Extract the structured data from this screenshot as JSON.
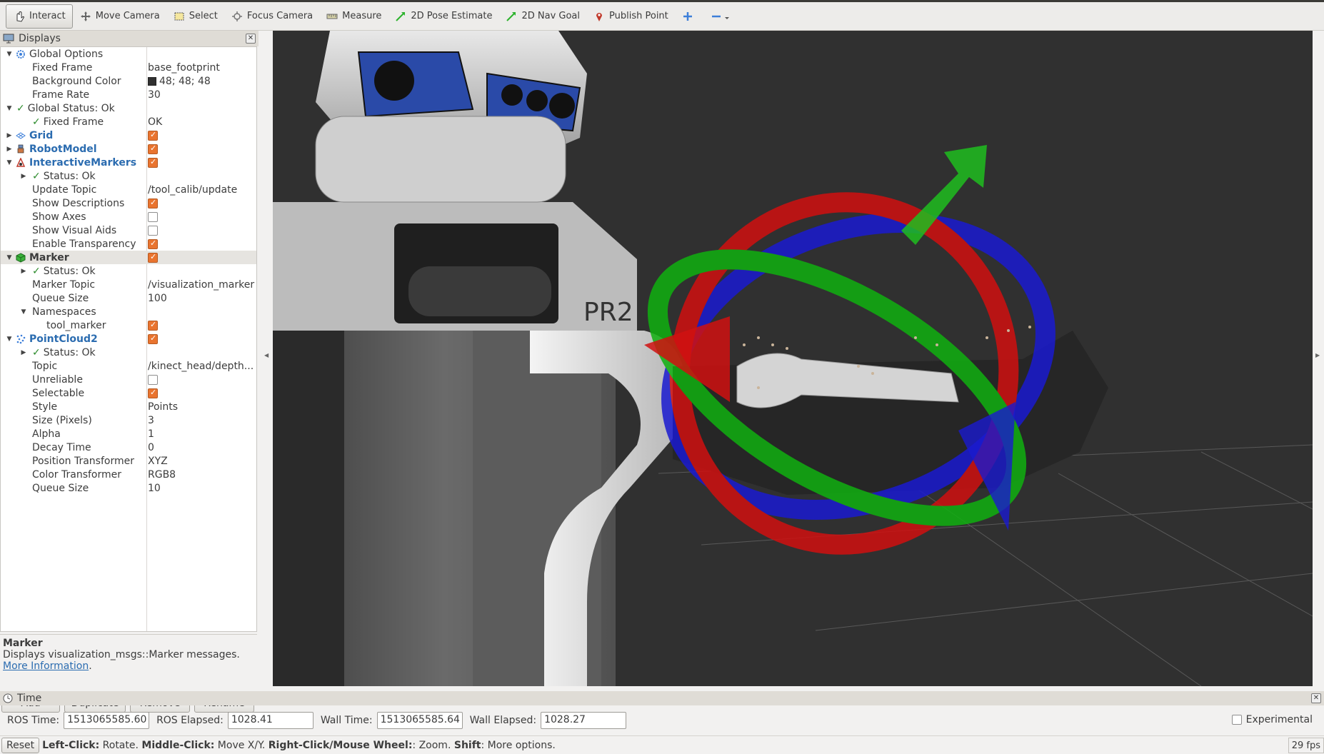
{
  "toolbar": {
    "tools": [
      {
        "id": "interact",
        "label": "Interact",
        "icon": "hand-cursor-icon",
        "active": true
      },
      {
        "id": "move-camera",
        "label": "Move Camera",
        "icon": "move-arrows-icon"
      },
      {
        "id": "select",
        "label": "Select",
        "icon": "select-box-icon"
      },
      {
        "id": "focus-camera",
        "label": "Focus Camera",
        "icon": "crosshair-icon"
      },
      {
        "id": "measure",
        "label": "Measure",
        "icon": "ruler-icon"
      },
      {
        "id": "2d-pose-estimate",
        "label": "2D Pose Estimate",
        "icon": "green-arrow-icon"
      },
      {
        "id": "2d-nav-goal",
        "label": "2D Nav Goal",
        "icon": "green-arrow-icon"
      },
      {
        "id": "publish-point",
        "label": "Publish Point",
        "icon": "map-pin-icon"
      }
    ],
    "add_tool_icon": "plus-icon",
    "remove_tool_icon": "minus-dropdown-icon"
  },
  "displays": {
    "title": "Displays",
    "rows": [
      {
        "name": "Global Options",
        "value": ""
      },
      {
        "name": "Fixed Frame",
        "value": "base_footprint"
      },
      {
        "name": "Background Color",
        "value": "48; 48; 48"
      },
      {
        "name": "Frame Rate",
        "value": "30"
      },
      {
        "name": "Global Status: Ok",
        "value": ""
      },
      {
        "name": "Fixed Frame",
        "value": "OK"
      },
      {
        "name": "Grid",
        "value": ""
      },
      {
        "name": "RobotModel",
        "value": ""
      },
      {
        "name": "InteractiveMarkers",
        "value": ""
      },
      {
        "name": "Status: Ok",
        "value": ""
      },
      {
        "name": "Update Topic",
        "value": "/tool_calib/update"
      },
      {
        "name": "Show Descriptions",
        "value": ""
      },
      {
        "name": "Show Axes",
        "value": ""
      },
      {
        "name": "Show Visual Aids",
        "value": ""
      },
      {
        "name": "Enable Transparency",
        "value": ""
      },
      {
        "name": "Marker",
        "value": ""
      },
      {
        "name": "Status: Ok",
        "value": ""
      },
      {
        "name": "Marker Topic",
        "value": "/visualization_marker"
      },
      {
        "name": "Queue Size",
        "value": "100"
      },
      {
        "name": "Namespaces",
        "value": ""
      },
      {
        "name": "tool_marker",
        "value": ""
      },
      {
        "name": "PointCloud2",
        "value": ""
      },
      {
        "name": "Status: Ok",
        "value": ""
      },
      {
        "name": "Topic",
        "value": "/kinect_head/depth..."
      },
      {
        "name": "Unreliable",
        "value": ""
      },
      {
        "name": "Selectable",
        "value": ""
      },
      {
        "name": "Style",
        "value": "Points"
      },
      {
        "name": "Size (Pixels)",
        "value": "3"
      },
      {
        "name": "Alpha",
        "value": "1"
      },
      {
        "name": "Decay Time",
        "value": "0"
      },
      {
        "name": "Position Transformer",
        "value": "XYZ"
      },
      {
        "name": "Color Transformer",
        "value": "RGB8"
      },
      {
        "name": "Queue Size",
        "value": "10"
      }
    ],
    "background_color_swatch": "#303030"
  },
  "description": {
    "title": "Marker",
    "text": "Displays visualization_msgs::Marker messages.",
    "link": "More Information",
    "link_suffix": "."
  },
  "buttons": {
    "add": "Add",
    "duplicate": "Duplicate",
    "remove": "Remove",
    "rename": "Rename"
  },
  "view": {
    "robot_label": "PR2",
    "background": "#303030"
  },
  "time": {
    "title": "Time",
    "ros_time_label": "ROS Time:",
    "ros_time": "1513065585.60",
    "ros_elapsed_label": "ROS Elapsed:",
    "ros_elapsed": "1028.41",
    "wall_time_label": "Wall Time:",
    "wall_time": "1513065585.64",
    "wall_elapsed_label": "Wall Elapsed:",
    "wall_elapsed": "1028.27",
    "experimental": "Experimental"
  },
  "status": {
    "reset": "Reset",
    "k1": "Left-Click:",
    "v1": " Rotate. ",
    "k2": "Middle-Click:",
    "v2": " Move X/Y. ",
    "k3": "Right-Click/Mouse Wheel:",
    "v3": ": Zoom. ",
    "k4": "Shift",
    "v4": ": More options.",
    "fps": "29 fps"
  },
  "colors": {
    "accent_checkbox": "#e9742f",
    "link": "#2b6cb0",
    "status_ok": "#2a8a2a"
  }
}
